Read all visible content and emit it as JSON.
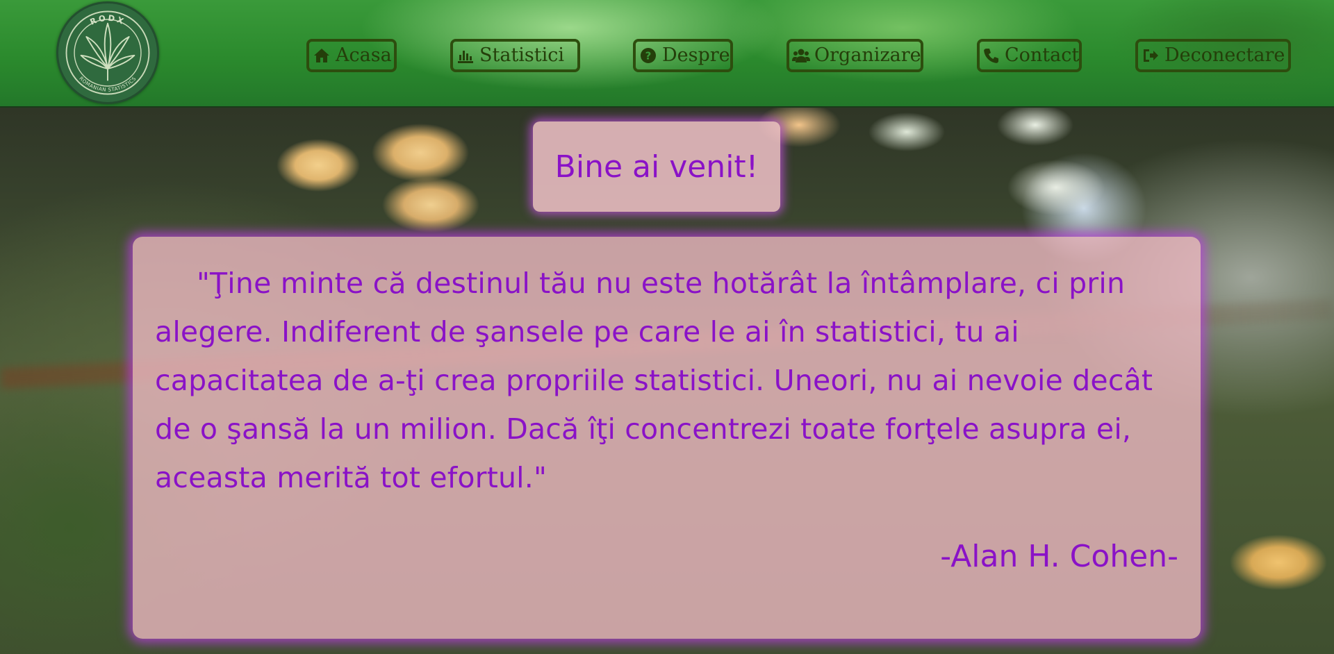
{
  "logo": {
    "top_text": "RODX",
    "bottom_text": "ROMANIAN STATISTICS",
    "icon": "leaf-icon"
  },
  "nav": {
    "items": [
      {
        "label": "Acasa",
        "icon": "home-icon"
      },
      {
        "label": "Statistici",
        "icon": "bar-chart-icon"
      },
      {
        "label": "Despre",
        "icon": "question-circle-icon"
      },
      {
        "label": "Organizare",
        "icon": "users-icon"
      },
      {
        "label": "Contact",
        "icon": "phone-icon"
      },
      {
        "label": "Deconectare",
        "icon": "sign-out-icon"
      }
    ]
  },
  "welcome": {
    "text": "Bine ai venit!"
  },
  "quote": {
    "text": "\"Ţine minte că destinul tău nu este hotărât la întâmplare, ci prin alegere. Indiferent de şansele pe care le ai în statistici, tu ai capacitatea de a-ţi crea propriile statistici. Uneori, nu ai nevoie decât de o şansă la un milion. Dacă îţi concentrezi toate forţele asupra ei, aceasta merită tot efortul.\"",
    "author": "-Alan H. Cohen-"
  },
  "colors": {
    "header_green": "#2b8a2d",
    "nav_border": "#2d4d0e",
    "text_purple": "#8a12c7",
    "box_pink": "#f0bac4",
    "glow_purple": "#be3ce6"
  }
}
